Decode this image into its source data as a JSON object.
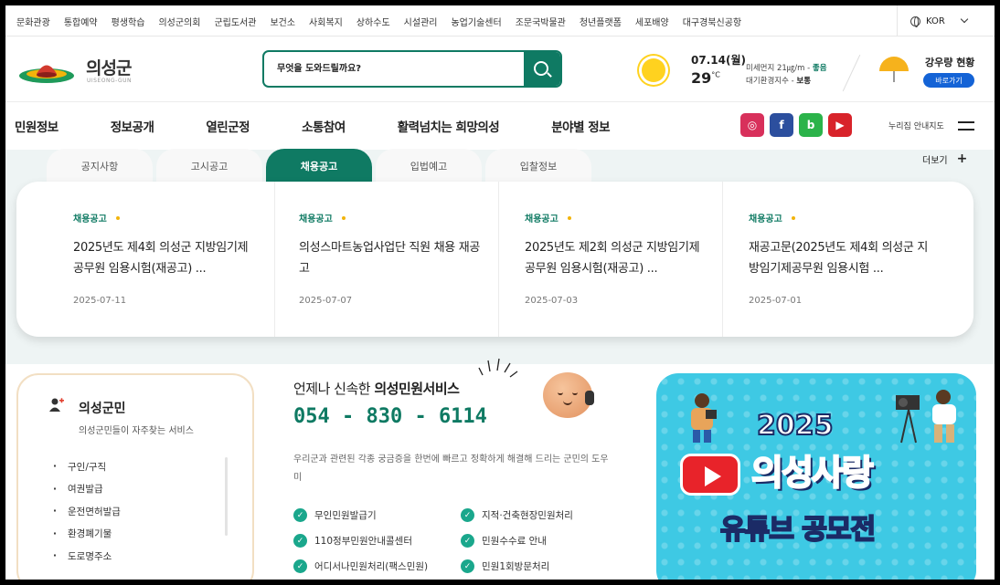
{
  "utility_links": [
    "문화관광",
    "통합예약",
    "평생학습",
    "의성군의회",
    "군립도서관",
    "보건소",
    "사회복지",
    "상하수도",
    "시설관리",
    "농업기술센터",
    "조문국박물관",
    "청년플랫폼",
    "세포배양",
    "대구경북신공항"
  ],
  "language": "KOR",
  "logo": {
    "title": "의성군",
    "subtitle": "UISEONG-GUN"
  },
  "search": {
    "placeholder": "무엇을 도와드릴까요?"
  },
  "weather": {
    "date": "07.14(월)",
    "temperature": "29",
    "unit": "°C",
    "dust_label": "미세먼지 21㎍/m - ",
    "dust_status": "좋음",
    "air_label": "대기환경지수 - ",
    "air_status": "보통"
  },
  "rain": {
    "title": "강우량 현황",
    "button": "바로가기"
  },
  "nav": {
    "items": [
      "민원정보",
      "정보공개",
      "열린군정",
      "소통참여",
      "활력넘치는 희망의성",
      "분야별 정보"
    ],
    "sitemap": "누리집 안내지도"
  },
  "sns": {
    "instagram": "◎",
    "facebook": "f",
    "blog": "b",
    "youtube": "▶"
  },
  "notice": {
    "tabs": [
      "공지사항",
      "고시공고",
      "채용공고",
      "입법예고",
      "입찰정보"
    ],
    "active_tab": "채용공고",
    "more": "더보기",
    "items": [
      {
        "category": "채용공고",
        "title": "2025년도 제4회 의성군 지방임기제공무원 임용시험(재공고) ...",
        "date": "2025-07-11"
      },
      {
        "category": "채용공고",
        "title": "의성스마트농업사업단 직원 채용 재공고",
        "date": "2025-07-07"
      },
      {
        "category": "채용공고",
        "title": "2025년도 제2회 의성군 지방임기제공무원 임용시험(재공고) ...",
        "date": "2025-07-03"
      },
      {
        "category": "채용공고",
        "title": "재공고문(2025년도 제4회 의성군 지방임기제공무원 임용시험 ...",
        "date": "2025-07-01"
      }
    ]
  },
  "civil": {
    "title": "의성군민",
    "subtitle": "의성군민들이 자주찾는 서비스",
    "items": [
      "구인/구직",
      "여권발급",
      "운전면허발급",
      "환경폐기물",
      "도로명주소"
    ]
  },
  "service": {
    "headline_prefix": "언제나 신속한 ",
    "headline_bold": "의성민원서비스",
    "phone": "054 - 830 - 6114",
    "description": "우리군과 관련된 각종 궁금증을 한번에 빠르고 정확하게 해결해 드리는 군민의 도우미",
    "checks": [
      "무인민원발급기",
      "지적·건축현장민원처리",
      "110정부민원안내콜센터",
      "민원수수료 안내",
      "어디서나민원처리(팩스민원)",
      "민원1회방문처리"
    ]
  },
  "banner": {
    "year": "2025",
    "title": "의성사랑",
    "subtitle": "유튜브 공모전"
  },
  "colors": {
    "brand": "#0f7a63",
    "accent": "#f2b40b",
    "link_blue": "#1463d6"
  }
}
